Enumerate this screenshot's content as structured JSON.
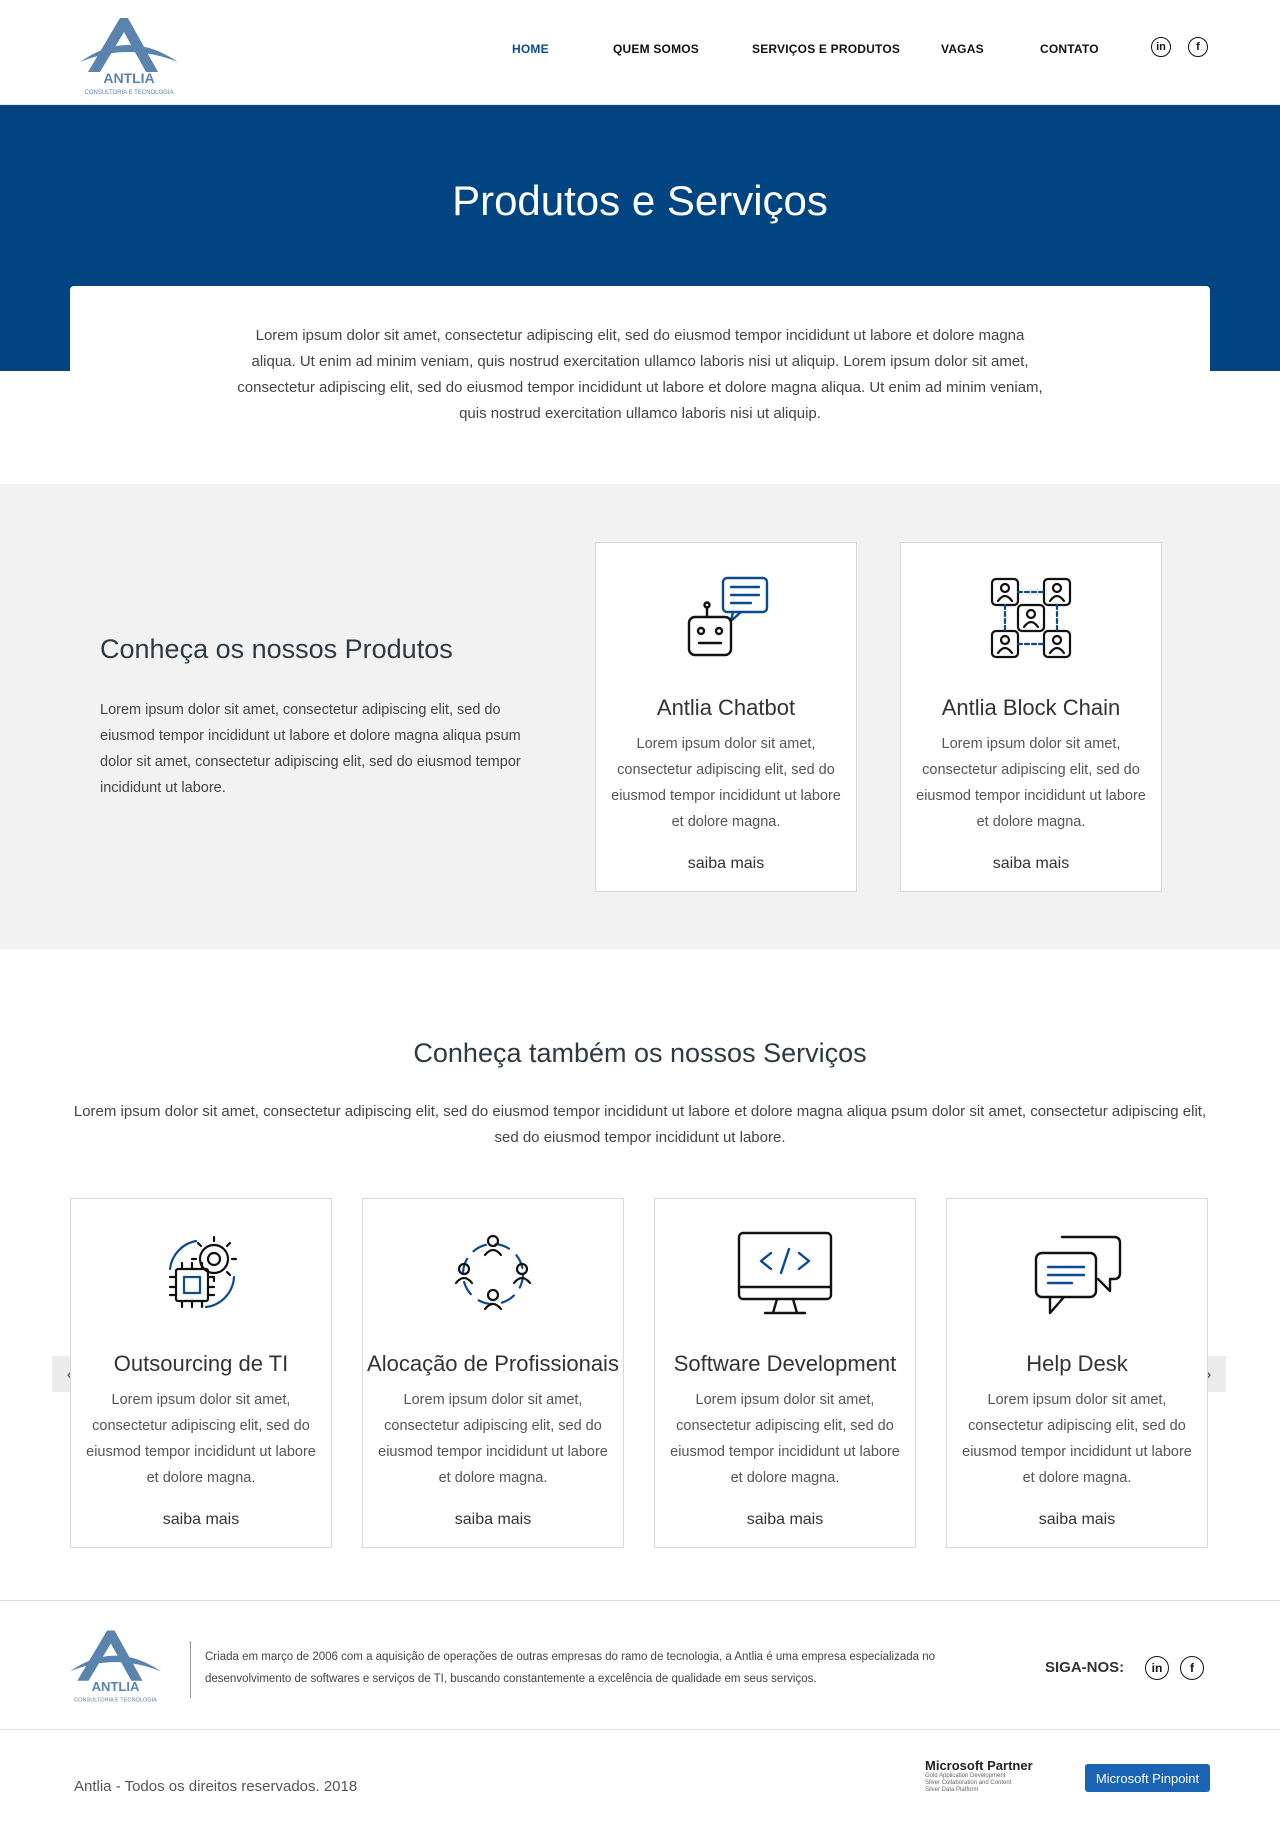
{
  "header": {
    "brand": "ANTLIA",
    "tagline": "CONSULTORIA E TECNOLOGIA",
    "nav": [
      {
        "label": "HOME"
      },
      {
        "label": "QUEM SOMOS"
      },
      {
        "label": "SERVIÇOS E PRODUTOS"
      },
      {
        "label": "VAGAS"
      },
      {
        "label": "CONTATO"
      }
    ],
    "social": {
      "linkedin": "in",
      "facebook": "f"
    }
  },
  "hero": {
    "title": "Produtos e Serviços",
    "intro": "Lorem ipsum dolor sit amet, consectetur adipiscing elit, sed do eiusmod tempor incididunt ut labore et dolore magna aliqua. Ut enim ad minim veniam, quis nostrud exercitation ullamco laboris nisi ut aliquip. Lorem ipsum dolor sit amet, consectetur adipiscing elit, sed do eiusmod tempor incididunt ut labore et dolore magna aliqua. Ut enim ad minim veniam, quis nostrud exercitation ullamco laboris nisi ut aliquip."
  },
  "products": {
    "title": "Conheça os nossos Produtos",
    "description": "Lorem ipsum dolor sit amet, consectetur adipiscing elit, sed do eiusmod tempor incididunt ut labore et dolore magna aliqua psum dolor sit amet, consectetur adipiscing elit, sed do eiusmod tempor incididunt ut labore.",
    "items": [
      {
        "title": "Antlia Chatbot",
        "text": "Lorem ipsum dolor sit amet, consectetur adipiscing elit, sed do eiusmod tempor incididunt ut labore et dolore magna.",
        "link": "saiba mais",
        "icon": "chatbot-icon"
      },
      {
        "title": "Antlia Block Chain",
        "text": "Lorem ipsum dolor sit amet, consectetur adipiscing elit, sed do eiusmod tempor incididunt ut labore et dolore magna.",
        "link": "saiba mais",
        "icon": "blockchain-icon"
      }
    ]
  },
  "services": {
    "title": "Conheça também os nossos Serviços",
    "description": "Lorem ipsum dolor sit amet, consectetur adipiscing elit, sed do eiusmod tempor incididunt ut labore et dolore magna aliqua psum dolor sit amet, consectetur adipiscing elit, sed do eiusmod tempor incididunt ut labore.",
    "items": [
      {
        "title": "Outsourcing de TI",
        "text": "Lorem ipsum dolor sit amet, consectetur adipiscing elit, sed do eiusmod tempor incididunt ut labore et dolore magna.",
        "link": "saiba mais",
        "icon": "chip-gear-icon"
      },
      {
        "title": "Alocação de Profissionais",
        "text": "Lorem ipsum dolor sit amet, consectetur adipiscing elit, sed do eiusmod tempor incididunt ut labore et dolore magna.",
        "link": "saiba mais",
        "icon": "people-network-icon"
      },
      {
        "title": "Software Development",
        "text": "Lorem ipsum dolor sit amet, consectetur adipiscing elit, sed do eiusmod tempor incididunt ut labore et dolore magna.",
        "link": "saiba mais",
        "icon": "monitor-code-icon"
      },
      {
        "title": "Help Desk",
        "text": "Lorem ipsum dolor sit amet, consectetur adipiscing elit, sed do eiusmod tempor incididunt ut labore et dolore magna.",
        "link": "saiba mais",
        "icon": "chat-bubbles-icon"
      }
    ],
    "prev": "‹",
    "next": "›"
  },
  "footer": {
    "about": "Criada em março de 2006 com a aquisição de operações de outras empresas do ramo de tecnologia, a Antlia é uma empresa especializada no desenvolvimento de softwares e serviços de TI, buscando constantemente a excelência de qualidade em seus serviços.",
    "follow": "SIGA-NOS:",
    "copyright": "Antlia - Todos os direitos reservados. 2018",
    "ms_partner": "Microsoft Partner",
    "ms_partner_lines": [
      "Gold Application Development",
      "Silver Collaboration and Content",
      "Silver Data Platform"
    ],
    "ms_pinpoint": "Microsoft Pinpoint"
  },
  "colors": {
    "primary": "#014482",
    "accent": "#0b4a8f",
    "section_bg": "#f2f2f2",
    "logo": "#5a84ad"
  }
}
